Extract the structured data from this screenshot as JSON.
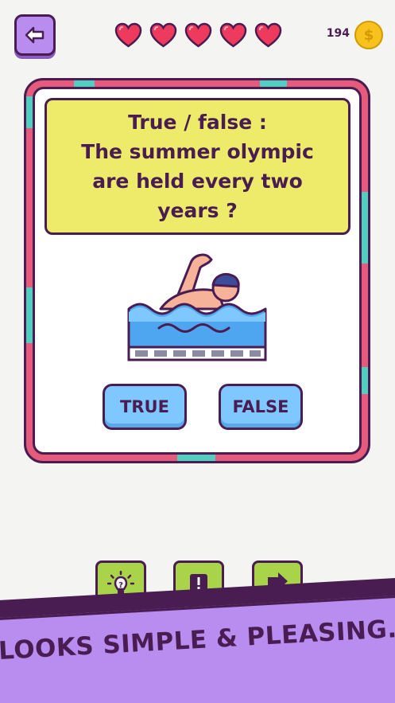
{
  "header": {
    "back_icon": "arrow-left-icon",
    "lives": 5,
    "coin_count": "194",
    "coin_symbol": "$"
  },
  "question": {
    "text_line1": "True / false :",
    "text_line2": "The summer olympic",
    "text_line3": "are held every two",
    "text_line4": "years ?",
    "illustration": "swimmer-illustration"
  },
  "answers": {
    "true_label": "TRUE",
    "false_label": "FALSE"
  },
  "tools": {
    "hint_icon": "lightbulb-icon",
    "report_icon": "exclamation-icon",
    "skip_icon": "arrow-right-icon"
  },
  "banner": {
    "text": "LOOKS SIMPLE & PLEASING."
  },
  "colors": {
    "background": "#f4f4f2",
    "outline": "#4a1d52",
    "frame_pink": "#e65a7c",
    "frame_teal": "#4fcfbf",
    "question_yellow": "#eeeb6a",
    "answer_blue": "#7ec8ff",
    "tool_green": "#a9d44a",
    "accent_purple": "#b98cf0",
    "heart_red": "#ee3a5c",
    "coin_gold": "#f7c21d"
  }
}
